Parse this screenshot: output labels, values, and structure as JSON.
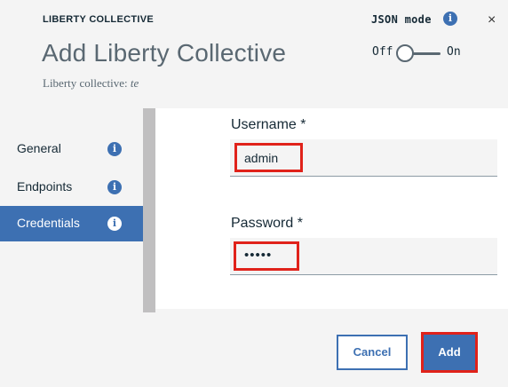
{
  "header": {
    "kicker": "LIBERTY COLLECTIVE",
    "title": "Add Liberty Collective",
    "subtitle_label": "Liberty collective:",
    "subtitle_value": "te"
  },
  "json_mode": {
    "label": "JSON mode",
    "off_label": "Off",
    "on_label": "On",
    "state": "off",
    "info_icon": "i"
  },
  "close_icon": "×",
  "sidebar": {
    "items": [
      {
        "label": "General",
        "info_icon": "i",
        "active": false
      },
      {
        "label": "Endpoints",
        "info_icon": "i",
        "active": false
      },
      {
        "label": "Credentials",
        "info_icon": "i",
        "active": true
      }
    ]
  },
  "form": {
    "username": {
      "label": "Username *",
      "value": "admin"
    },
    "password": {
      "label": "Password *",
      "value": "•••••"
    }
  },
  "buttons": {
    "cancel": "Cancel",
    "add": "Add"
  },
  "colors": {
    "accent": "#3d70b2",
    "highlight": "#e0221a",
    "background": "#f4f4f4"
  }
}
